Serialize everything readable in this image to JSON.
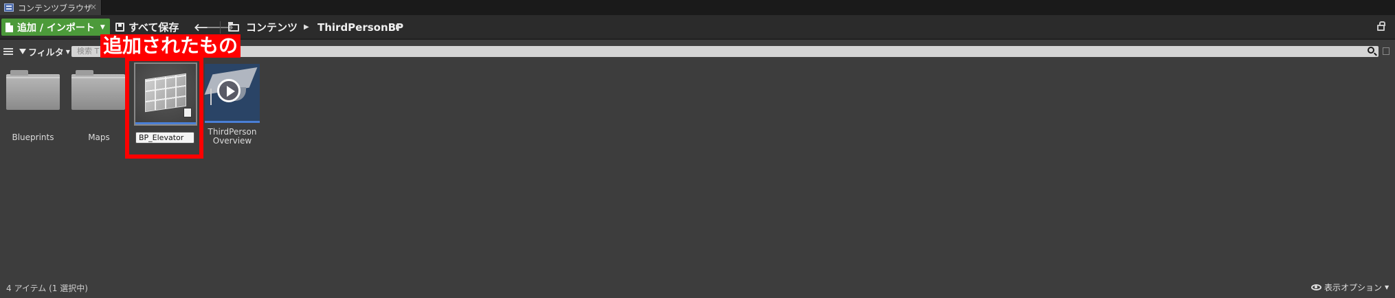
{
  "tab": {
    "title": "コンテンツブラウザ",
    "close": "×"
  },
  "toolbar": {
    "add_import_label": "追加 / インポート",
    "save_all_label": "すべて保存",
    "back_glyph": "🡐",
    "forward_glyph": "🡒",
    "breadcrumb": [
      {
        "label": "コンテンツ"
      },
      {
        "label": "ThirdPersonBP"
      }
    ],
    "crumb_sep": "▶"
  },
  "filter": {
    "filter_label": "フィルタ",
    "search_placeholder": "検索 T"
  },
  "assets": [
    {
      "label": "Blueprints",
      "type": "folder"
    },
    {
      "label": "Maps",
      "type": "folder"
    },
    {
      "label": "BP_Elevator",
      "type": "blueprint",
      "selected": true,
      "renaming": true
    },
    {
      "label_line1": "ThirdPerson",
      "label_line2": "Overview",
      "type": "tutorial"
    }
  ],
  "annotation": {
    "text": "追加されたもの",
    "color": "#ff0000"
  },
  "status": {
    "items_text": "4 アイテム (1 選択中)",
    "view_options_label": "表示オプション"
  },
  "colors": {
    "accent_green": "#4c9a3a",
    "selection_blue": "#4a7fd6",
    "background": "#3d3d3d"
  }
}
